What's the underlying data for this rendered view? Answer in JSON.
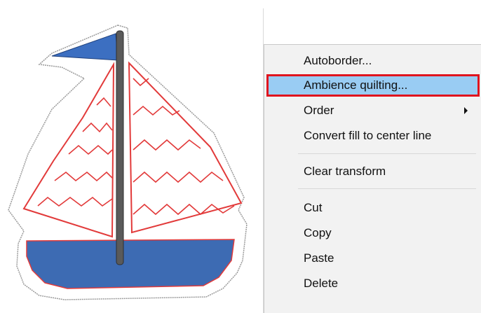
{
  "context_menu": {
    "items": [
      {
        "label": "Autoborder..."
      },
      {
        "label": "Ambience quilting..."
      },
      {
        "label": "Order"
      },
      {
        "label": "Convert fill to center line"
      },
      {
        "label": "Clear transform"
      },
      {
        "label": "Cut"
      },
      {
        "label": "Copy"
      },
      {
        "label": "Paste"
      },
      {
        "label": "Delete"
      }
    ],
    "highlighted_item": "Ambience quilting...",
    "highlight_outline_color": "#e0141e",
    "highlight_fill_color": "#99ccf3"
  },
  "canvas": {
    "design": "sailboat-embroidery",
    "colors": {
      "hull": "#3d6bb3",
      "flag": "#3c6fc1",
      "mast": "#5a5a5a",
      "sail_stitch": "#e23a3a"
    }
  }
}
